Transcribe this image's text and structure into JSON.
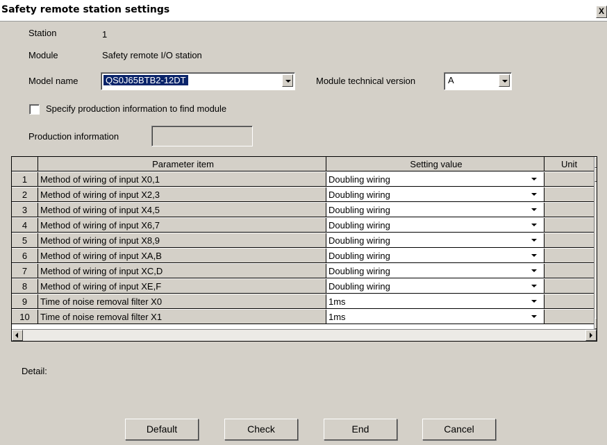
{
  "window": {
    "title": "Safety remote station settings",
    "close_glyph": "X"
  },
  "station": {
    "label": "Station",
    "value": "1"
  },
  "module": {
    "label": "Module",
    "value": "Safety remote I/O station"
  },
  "model": {
    "label": "Model name",
    "value": "QS0J65BTB2-12DT"
  },
  "tech_version": {
    "label": "Module technical version",
    "value": "A"
  },
  "specify_production": {
    "label": "Specify production information to find module",
    "checked": false
  },
  "production_info": {
    "label": "Production information",
    "value": ""
  },
  "table": {
    "headers": {
      "num": "",
      "item": "Parameter item",
      "value": "Setting value",
      "unit": "Unit"
    },
    "rows": [
      {
        "num": "1",
        "item": "Method of wiring of input X0,1",
        "value": "Doubling wiring",
        "unit": ""
      },
      {
        "num": "2",
        "item": "Method of wiring of input X2,3",
        "value": "Doubling wiring",
        "unit": ""
      },
      {
        "num": "3",
        "item": "Method of wiring of input X4,5",
        "value": "Doubling wiring",
        "unit": ""
      },
      {
        "num": "4",
        "item": "Method of wiring of input X6,7",
        "value": "Doubling wiring",
        "unit": ""
      },
      {
        "num": "5",
        "item": "Method of wiring of input X8,9",
        "value": "Doubling wiring",
        "unit": ""
      },
      {
        "num": "6",
        "item": "Method of wiring of input XA,B",
        "value": "Doubling wiring",
        "unit": ""
      },
      {
        "num": "7",
        "item": "Method of wiring of input XC,D",
        "value": "Doubling wiring",
        "unit": ""
      },
      {
        "num": "8",
        "item": "Method of wiring of input XE,F",
        "value": "Doubling wiring",
        "unit": ""
      },
      {
        "num": "9",
        "item": "Time of noise removal filter X0",
        "value": "1ms",
        "unit": ""
      },
      {
        "num": "10",
        "item": "Time of noise removal filter X1",
        "value": "1ms",
        "unit": ""
      }
    ]
  },
  "detail": {
    "label": "Detail:",
    "text": ""
  },
  "buttons": {
    "default": "Default",
    "check": "Check",
    "end": "End",
    "cancel": "Cancel"
  },
  "colors": {
    "face": "#d4d0c8",
    "selection": "#0a246a"
  }
}
